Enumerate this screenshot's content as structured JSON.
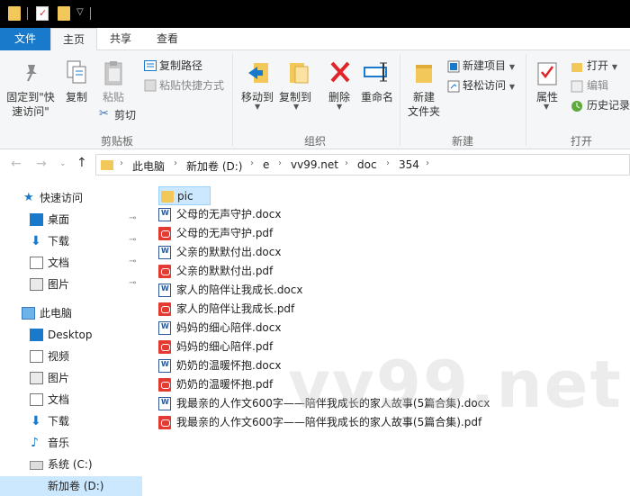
{
  "ribbon_tabs": {
    "file": "文件",
    "home": "主页",
    "share": "共享",
    "view": "查看"
  },
  "clipboard": {
    "pin_label_1": "固定到\"快",
    "pin_label_2": "速访问\"",
    "copy": "复制",
    "paste": "粘贴",
    "copy_path": "复制路径",
    "paste_shortcut": "粘贴快捷方式",
    "cut": "剪切",
    "group": "剪贴板"
  },
  "organize": {
    "move_to": "移动到",
    "copy_to": "复制到",
    "delete": "删除",
    "rename": "重命名",
    "group": "组织"
  },
  "new": {
    "new_folder_1": "新建",
    "new_folder_2": "文件夹",
    "new_item": "新建项目",
    "easy_access": "轻松访问",
    "group": "新建"
  },
  "open": {
    "properties": "属性",
    "open": "打开",
    "edit": "编辑",
    "history": "历史记录",
    "group": "打开"
  },
  "address": {
    "crumbs": [
      "此电脑",
      "新加卷 (D:)",
      "e",
      "vv99.net",
      "doc",
      "354"
    ]
  },
  "nav": {
    "quick_access": "快速访问",
    "qa_items": [
      "桌面",
      "下载",
      "文档",
      "图片"
    ],
    "this_pc": "此电脑",
    "pc_items": [
      "Desktop",
      "视频",
      "图片",
      "文档",
      "下载",
      "音乐",
      "系统 (C:)",
      "新加卷 (D:)"
    ]
  },
  "files": [
    {
      "name": "pic",
      "type": "folder"
    },
    {
      "name": "父母的无声守护.docx",
      "type": "docx"
    },
    {
      "name": "父母的无声守护.pdf",
      "type": "pdf"
    },
    {
      "name": "父亲的默默付出.docx",
      "type": "docx"
    },
    {
      "name": "父亲的默默付出.pdf",
      "type": "pdf"
    },
    {
      "name": "家人的陪伴让我成长.docx",
      "type": "docx"
    },
    {
      "name": "家人的陪伴让我成长.pdf",
      "type": "pdf"
    },
    {
      "name": "妈妈的细心陪伴.docx",
      "type": "docx"
    },
    {
      "name": "妈妈的细心陪伴.pdf",
      "type": "pdf"
    },
    {
      "name": "奶奶的温暖怀抱.docx",
      "type": "docx"
    },
    {
      "name": "奶奶的温暖怀抱.pdf",
      "type": "pdf"
    },
    {
      "name": "我最亲的人作文600字——陪伴我成长的家人故事(5篇合集).docx",
      "type": "docx"
    },
    {
      "name": "我最亲的人作文600字——陪伴我成长的家人故事(5篇合集).pdf",
      "type": "pdf"
    }
  ],
  "watermark": "vv99.net",
  "colors": {
    "file_tab": "#1979ca",
    "folder": "#f3c85a",
    "pdf": "#e33b32",
    "word": "#2b5797",
    "selection": "#cce8ff"
  }
}
